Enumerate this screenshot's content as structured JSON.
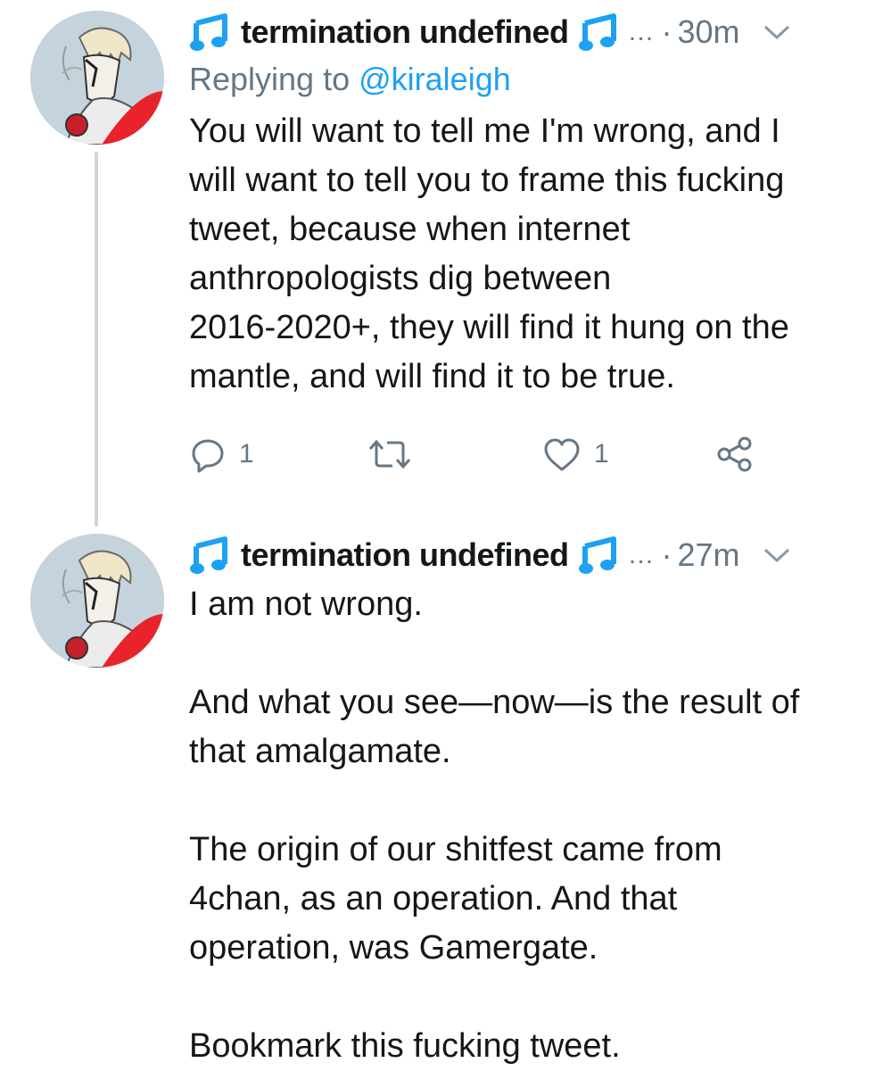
{
  "tweets": [
    {
      "display_name": "termination undefined",
      "ellipsis": "…",
      "separator": "·",
      "time": "30m",
      "replying_prefix": "Replying to",
      "replying_handle": "@kiraleigh",
      "text": "You will want to tell me I'm wrong, and I\nwill want to tell you to frame this fucking\ntweet, because when internet\nanthropologists dig between\n2016-2020+, they will find it hung on the\nmantle, and will find it to be true.",
      "reply_count": "1",
      "like_count": "1"
    },
    {
      "display_name": "termination undefined",
      "ellipsis": "…",
      "separator": "·",
      "time": "27m",
      "text": "I am not wrong.\n\nAnd what you see—now—is the result of\nthat amalgamate.\n\nThe origin of our shitfest came from\n4chan, as an operation. And that\noperation, was Gamergate.\n\nBookmark this fucking tweet."
    }
  ],
  "colors": {
    "accent": "#1da1f2",
    "muted": "#657786",
    "text": "#14171a",
    "thread_line": "#ccd6dd"
  },
  "icons": [
    "music-note-icon",
    "chevron-down-icon",
    "reply-icon",
    "retweet-icon",
    "like-icon",
    "share-icon"
  ]
}
